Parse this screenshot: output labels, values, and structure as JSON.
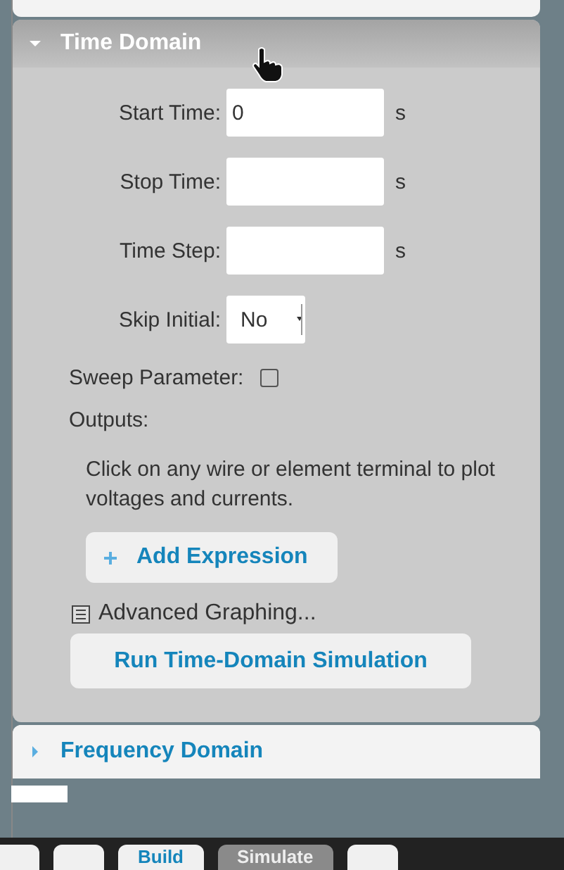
{
  "sections": [
    {
      "title": "Time Domain",
      "expanded": true,
      "fields": [
        {
          "kind": "text",
          "label": "Start Time:",
          "value": "0",
          "unit": "s"
        },
        {
          "kind": "text",
          "label": "Stop Time:",
          "unit": "s"
        },
        {
          "kind": "text",
          "label": "Time Step:",
          "unit": "s"
        },
        {
          "kind": "select",
          "label": "Skip Initial:",
          "value": "No"
        }
      ],
      "sweep": {
        "label": "Sweep Parameter:",
        "checked": false
      },
      "outputs_label": "Outputs:",
      "hint": "Click on any wire or element terminal to plot voltages and currents.",
      "add_button": "Add Expression",
      "advanced_link": "Advanced Graphing...",
      "run_button": "Run Time-Domain Simulation"
    },
    {
      "title": "Frequency Domain",
      "expanded": false
    }
  ],
  "toolbar": [
    {
      "kind": "icon",
      "selected": false
    },
    {
      "kind": "icon",
      "selected": false
    },
    {
      "kind": "text",
      "label": "Build",
      "selected": false
    },
    {
      "kind": "text",
      "label": "Simulate",
      "selected": true
    },
    {
      "kind": "icon",
      "selected": false
    }
  ]
}
